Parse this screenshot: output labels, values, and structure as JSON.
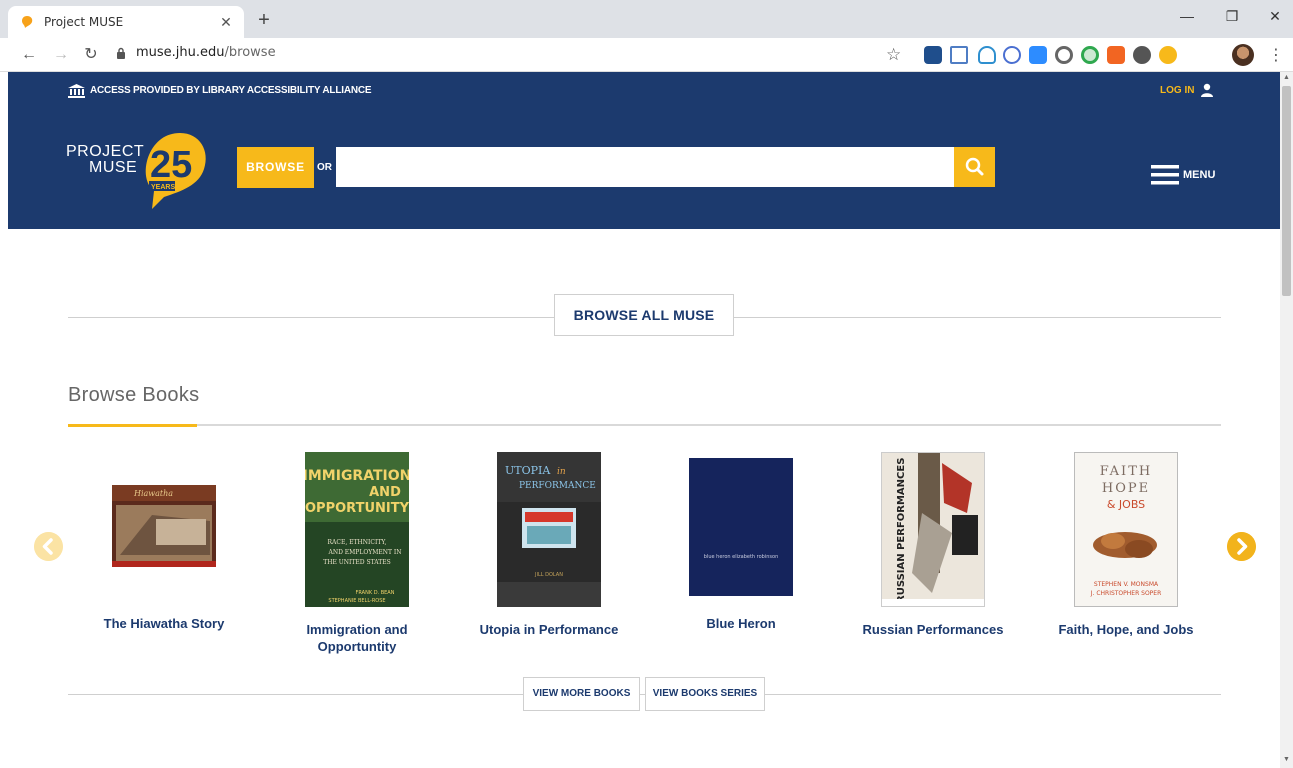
{
  "browser": {
    "tab_title": "Project MUSE",
    "url_host": "muse.jhu.edu",
    "url_path": "/browse"
  },
  "access_bar": {
    "text": "ACCESS PROVIDED BY LIBRARY ACCESSIBILITY ALLIANCE",
    "login_label": "LOG IN"
  },
  "header": {
    "logo_text_line1": "PROJECT",
    "logo_text_line2": "MUSE",
    "logo_badge_number": "25",
    "logo_badge_word": "YEARS",
    "browse_label": "BROWSE",
    "or_label": "OR",
    "search_placeholder": "",
    "menu_label": "MENU"
  },
  "browse_all": {
    "label": "BROWSE ALL MUSE"
  },
  "books_section": {
    "title": "Browse Books",
    "books": [
      {
        "title": "The Hiawatha Story",
        "cover_color": "#8a3a22"
      },
      {
        "title": "Immigration and Opportuntity",
        "cover_color": "#2e5a2f",
        "cover_text": "IMMIGRATION AND OPPORTUNITY"
      },
      {
        "title": "Utopia in Performance",
        "cover_color": "#2d2d2d",
        "cover_text": "UTOPIA in PERFORMANCE"
      },
      {
        "title": "Blue Heron",
        "cover_color": "#14235a",
        "cover_text": "blue heron elizabeth robinson"
      },
      {
        "title": "Russian Performances",
        "cover_color": "#e8e1d6",
        "cover_text": "RUSSIAN PERFORMANCES"
      },
      {
        "title": "Faith, Hope, and Jobs",
        "cover_color": "#f4f2ee",
        "cover_text_1": "FAITH",
        "cover_text_2": "HOPE",
        "cover_text_3": "& JOBS",
        "cover_authors_1": "STEPHEN V. MONSMA",
        "cover_authors_2": "J. CHRISTOPHER SOPER"
      }
    ],
    "view_more_label": "VIEW MORE BOOKS",
    "view_series_label": "VIEW BOOKS SERIES"
  },
  "colors": {
    "navy": "#1c3a6e",
    "gold": "#f7b91a"
  }
}
